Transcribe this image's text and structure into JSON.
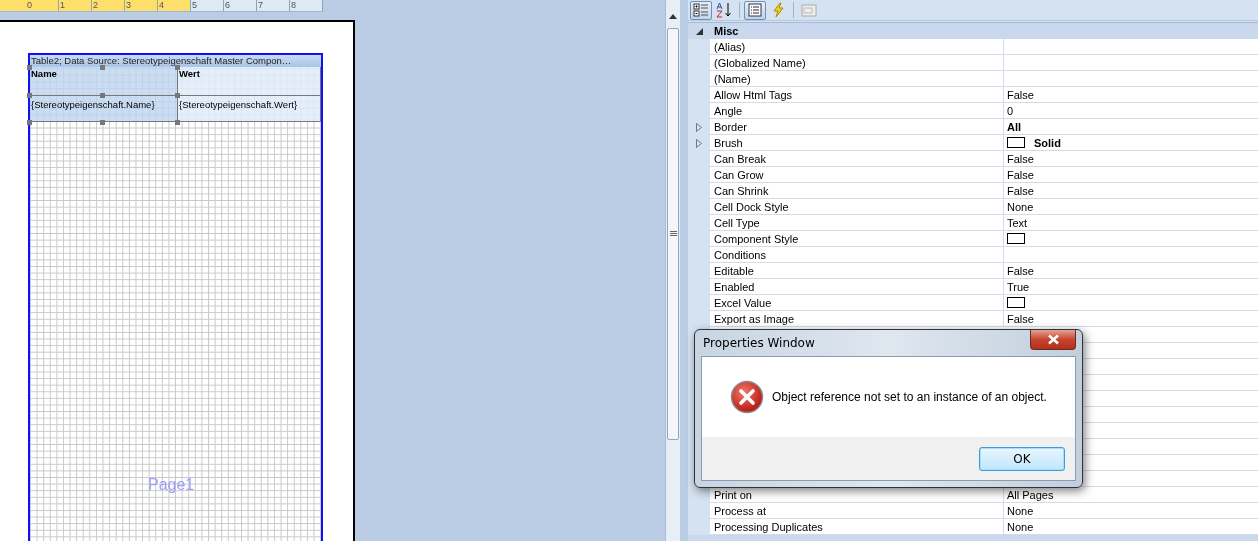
{
  "ruler": {
    "marks": [
      {
        "label": "0",
        "highlighted": true
      },
      {
        "label": "1",
        "highlighted": true
      },
      {
        "label": "2",
        "highlighted": true
      },
      {
        "label": "3",
        "highlighted": true
      },
      {
        "label": "4",
        "highlighted": true
      },
      {
        "label": "5",
        "highlighted": false
      },
      {
        "label": "6",
        "highlighted": false
      },
      {
        "label": "7",
        "highlighted": false
      },
      {
        "label": "8",
        "highlighted": false
      }
    ]
  },
  "report_page": {
    "table": {
      "caption": "Table2; Data Source: Stereotypeigenschaft  Master Compon…",
      "columns": [
        {
          "label": "Name",
          "selected": true
        },
        {
          "label": "Wert",
          "selected": false
        }
      ],
      "row": [
        {
          "text": "{Stereotypeigenschaft.Name}",
          "selected": true
        },
        {
          "text": "{Stereotypeigenschaft.Wert}",
          "selected": false
        }
      ]
    },
    "page_label": "Page1"
  },
  "toolbar": {
    "buttons": [
      {
        "kind": "categorized",
        "selected": true
      },
      {
        "kind": "alphabetical",
        "selected": false
      },
      {
        "kind": "properties",
        "selected": true
      },
      {
        "kind": "events",
        "selected": false
      },
      {
        "kind": "pages",
        "selected": false
      }
    ]
  },
  "properties": {
    "category": {
      "name": "Misc",
      "expanded": true
    },
    "rows": [
      {
        "name": "(Alias)",
        "kind": "plain",
        "expandable": false
      },
      {
        "name": "(Globalized Name)",
        "kind": "plain",
        "expandable": false
      },
      {
        "name": "(Name)",
        "kind": "plain",
        "expandable": false
      },
      {
        "name": "Allow Html Tags",
        "value": "False",
        "kind": "plain",
        "expandable": false
      },
      {
        "name": "Angle",
        "value": "0",
        "kind": "plain",
        "expandable": false
      },
      {
        "name": "Border",
        "value": "All",
        "kind": "bold",
        "expandable": true
      },
      {
        "name": "Brush",
        "value": "Solid",
        "kind": "swatch",
        "expandable": true
      },
      {
        "name": "Can Break",
        "value": "False",
        "kind": "plain",
        "expandable": false
      },
      {
        "name": "Can Grow",
        "value": "False",
        "kind": "plain",
        "expandable": false
      },
      {
        "name": "Can Shrink",
        "value": "False",
        "kind": "plain",
        "expandable": false
      },
      {
        "name": "Cell Dock Style",
        "value": "None",
        "kind": "plain",
        "expandable": false
      },
      {
        "name": "Cell Type",
        "value": "Text",
        "kind": "plain",
        "expandable": false
      },
      {
        "name": "Component Style",
        "kind": "swatch",
        "expandable": false
      },
      {
        "name": "Conditions",
        "kind": "plain",
        "expandable": false
      },
      {
        "name": "Editable",
        "value": "False",
        "kind": "plain",
        "expandable": false
      },
      {
        "name": "Enabled",
        "value": "True",
        "kind": "plain",
        "expandable": false
      },
      {
        "name": "Excel Value",
        "kind": "swatch",
        "expandable": false
      },
      {
        "name": "Export as Image",
        "value": "False",
        "kind": "plain",
        "expandable": false
      }
    ],
    "rows_below_dialog": [
      {
        "name": "Print on",
        "value": "All Pages",
        "kind": "plain",
        "expandable": false
      },
      {
        "name": "Process at",
        "value": "None",
        "kind": "plain",
        "expandable": false
      },
      {
        "name": "Processing Duplicates",
        "value": "None",
        "kind": "plain",
        "expandable": false
      }
    ]
  },
  "dialog": {
    "title": "Properties Window",
    "message": "Object reference not set to an instance of an object.",
    "buttons": [
      {
        "label": "OK",
        "default": true
      }
    ]
  }
}
